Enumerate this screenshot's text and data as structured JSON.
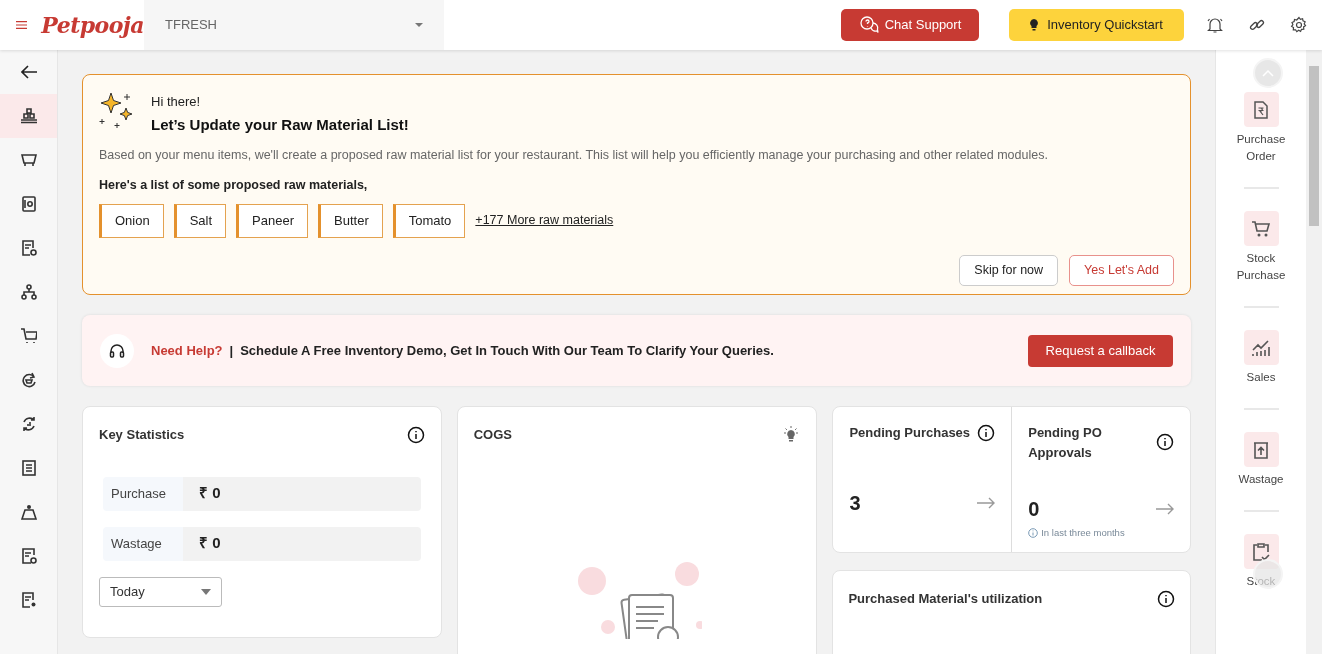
{
  "header": {
    "logo": "Petpooja",
    "outlet": "TFRESH",
    "chat_button": "Chat Support",
    "quickstart_button": "Inventory Quickstart"
  },
  "sidebar": {
    "items": [
      {
        "selected": true
      },
      {
        "selected": false
      },
      {
        "selected": false
      },
      {
        "selected": false
      },
      {
        "selected": false
      },
      {
        "selected": false
      },
      {
        "selected": false
      },
      {
        "selected": false
      },
      {
        "selected": false
      },
      {
        "selected": false
      },
      {
        "selected": false
      },
      {
        "selected": false
      }
    ]
  },
  "banner": {
    "greeting": "Hi there!",
    "title": "Let’s Update your Raw Material List!",
    "description": "Based on your menu items, we'll create a proposed raw material list for your restaurant. This list will help you efficiently manage your purchasing and other related modules.",
    "list_heading": "Here's a list of some proposed raw materials,",
    "materials": [
      "Onion",
      "Salt",
      "Paneer",
      "Butter",
      "Tomato"
    ],
    "more_link": "+177 More raw materials",
    "skip_button": "Skip for now",
    "add_button": "Yes Let's Add"
  },
  "help": {
    "label": "Need Help?",
    "separator": "|",
    "message": "Schedule A Free Inventory Demo, Get In Touch With Our Team To Clarify Your Queries.",
    "button": "Request a callback"
  },
  "key_statistics": {
    "title": "Key Statistics",
    "rows": [
      {
        "label": "Purchase",
        "value": "₹ 0"
      },
      {
        "label": "Wastage",
        "value": "₹ 0"
      }
    ],
    "period": "Today"
  },
  "cogs": {
    "title": "COGS"
  },
  "pending": [
    {
      "title": "Pending Purchases",
      "value": "3"
    },
    {
      "title": "Pending PO Approvals",
      "value": "0",
      "note": "In last three months"
    }
  ],
  "utilization": {
    "title": "Purchased Material's utilization"
  },
  "quick_links": [
    {
      "label": "Purchase Order"
    },
    {
      "label": "Stock Purchase"
    },
    {
      "label": "Sales"
    },
    {
      "label": "Wastage"
    },
    {
      "label": "Stock"
    }
  ]
}
